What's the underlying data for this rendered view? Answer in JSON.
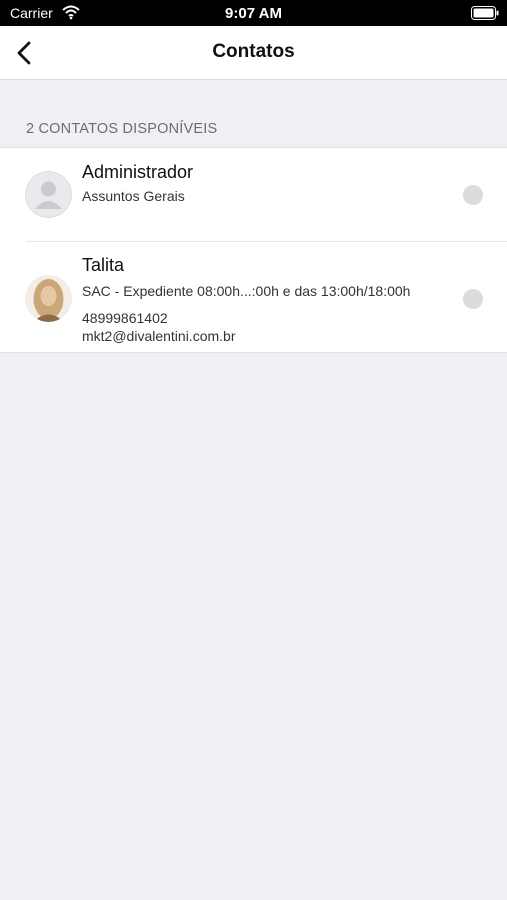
{
  "status_bar": {
    "carrier": "Carrier",
    "time": "9:07 AM",
    "wifi_icon": "wifi-icon",
    "battery_icon": "battery-icon"
  },
  "nav": {
    "title": "Contatos",
    "back_icon": "chevron-left-icon"
  },
  "section_header": "2 CONTATOS DISPONÍVEIS",
  "contacts": [
    {
      "name": "Administrador",
      "subtitle": "Assuntos Gerais",
      "avatar": "placeholder-avatar-icon"
    },
    {
      "name": "Talita",
      "subtitle": "SAC - Expediente 08:00h...:00h e das 13:00h/18:00h",
      "phone": "48999861402",
      "email": "mkt2@divalentini.com.br",
      "avatar": "photo-avatar"
    }
  ],
  "colors": {
    "background": "#efeff4",
    "radio": "#dcdcdf",
    "header_text": "#6d6d72"
  }
}
